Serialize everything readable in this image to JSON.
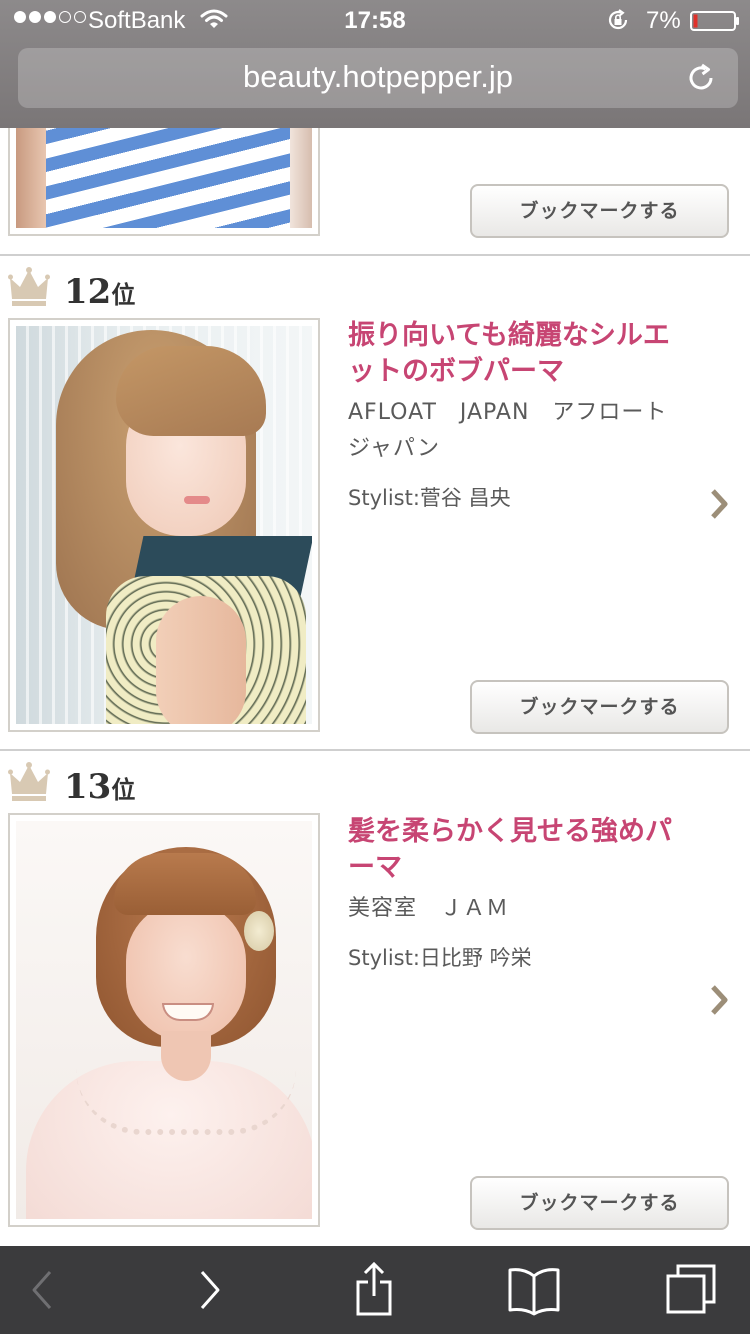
{
  "status_bar": {
    "carrier": "SoftBank",
    "time": "17:58",
    "battery": "7%",
    "signal_bars_total": 5,
    "signal_bars_filled": 3
  },
  "browser": {
    "url": "beauty.hotpepper.jp"
  },
  "ranking": [
    {
      "rank_number": "12",
      "rank_suffix": "位",
      "title": "振り向いても綺麗なシルエットのボブパーマ",
      "salon": "AFLOAT　JAPAN　アフロート　ジャパン",
      "stylist": "Stylist:菅谷 昌央",
      "bookmark_label": "ブックマークする"
    },
    {
      "rank_number": "13",
      "rank_suffix": "位",
      "title": "髪を柔らかく見せる強めパーマ",
      "salon": "美容室　ＪＡＭ",
      "stylist": "Stylist:日比野 吟栄",
      "bookmark_label": "ブックマークする"
    }
  ],
  "previous_entry": {
    "bookmark_label": "ブックマークする"
  },
  "colors": {
    "title_pink": "#c74573",
    "crown_beige": "#d8c9b3",
    "chevron": "#9c8e78"
  }
}
